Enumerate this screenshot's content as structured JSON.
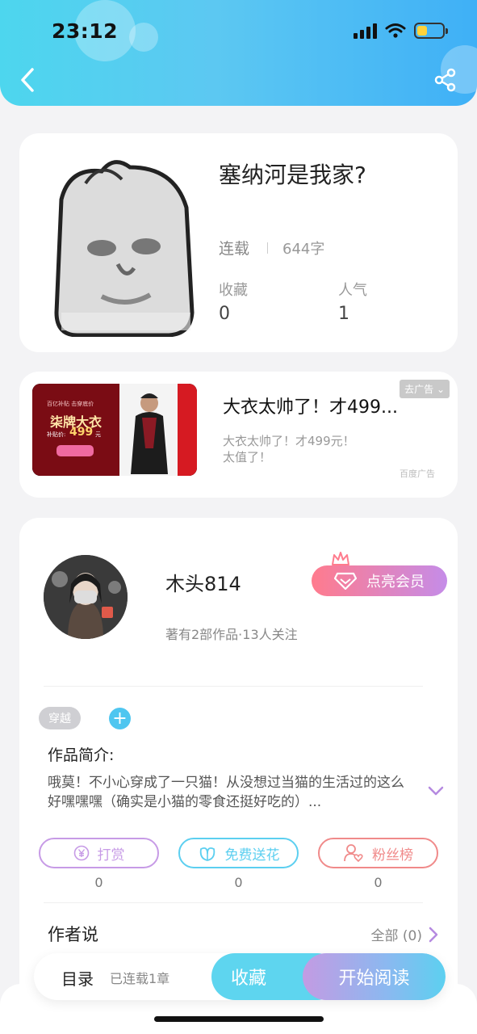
{
  "status": {
    "time": "23:12"
  },
  "book": {
    "title": "塞纳河是我家?",
    "status": "连载",
    "word_count": "644字",
    "favorites_label": "收藏",
    "favorites_value": "0",
    "popularity_label": "人气",
    "popularity_value": "1"
  },
  "ad": {
    "title": "大衣太帅了！才499...",
    "description": "大衣太帅了！才499元！太值了！",
    "close_tag": "去广告",
    "source": "百度广告",
    "image_text": {
      "top": "百亿补贴 击穿底价",
      "brand": "柒牌大衣",
      "price_label": "补贴价:",
      "price": "499",
      "unit": "元"
    }
  },
  "author": {
    "name": "木头814",
    "stats": "著有2部作品·13人关注",
    "vip_label": "点亮会员"
  },
  "intro": {
    "tag": "穿越",
    "label": "作品简介:",
    "text": "哦莫！不小心穿成了一只猫！从没想过当猫的生活过的这么好嘿嘿嘿（确实是小猫的零食还挺好吃的）..."
  },
  "actions": [
    {
      "label": "打赏",
      "count": "0",
      "color": "#c79be6"
    },
    {
      "label": "免费送花",
      "count": "0",
      "color": "#5ccff0"
    },
    {
      "label": "粉丝榜",
      "count": "0",
      "color": "#f08a8a"
    }
  ],
  "author_said": {
    "label": "作者说",
    "all": "全部 (0)"
  },
  "bottom": {
    "toc": "目录",
    "chapters": "已连载1章",
    "favorite": "收藏",
    "read": "开始阅读"
  }
}
